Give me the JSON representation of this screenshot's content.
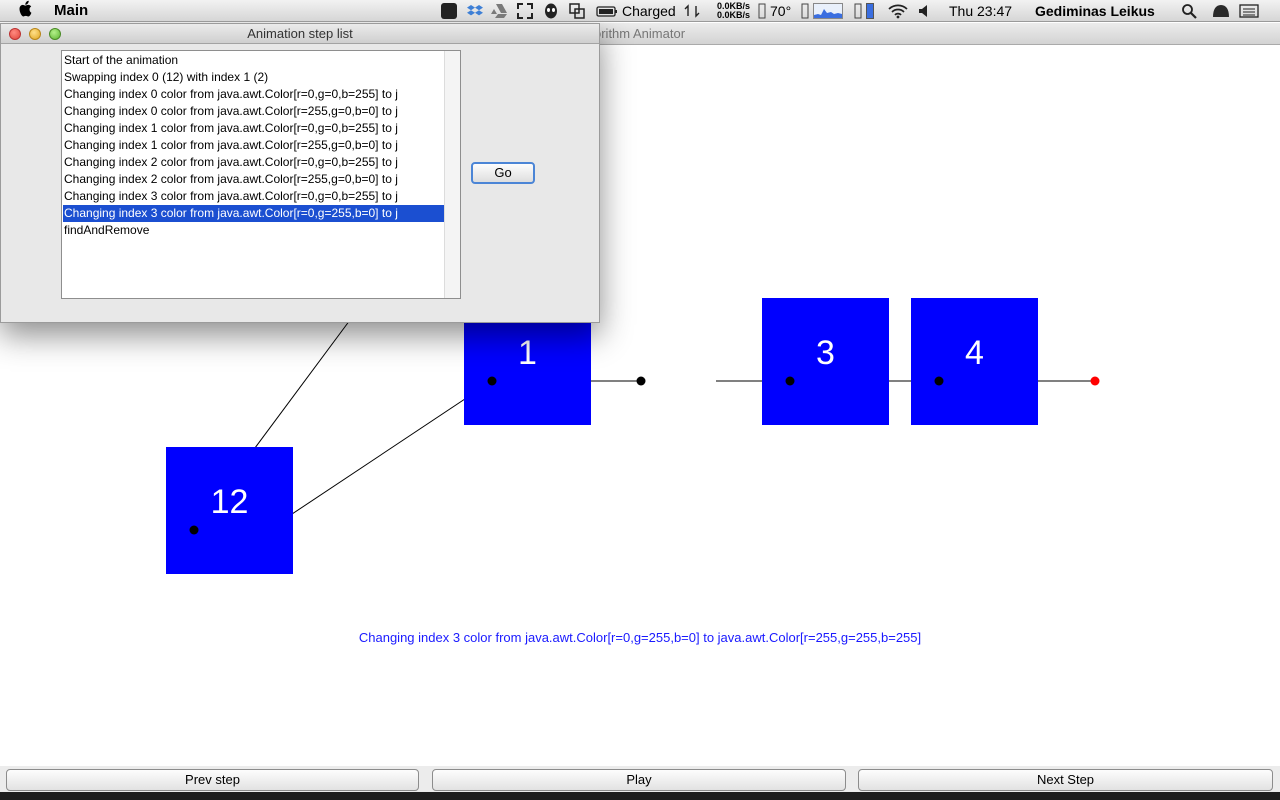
{
  "menubar": {
    "app_name": "Main",
    "battery_status": "Charged",
    "net_up": "0.0KB/s",
    "net_down": "0.0KB/s",
    "temperature": "70°",
    "clock": "Thu 23:47",
    "user": "Gediminas Leikus"
  },
  "main_window": {
    "title": "orithm Animator"
  },
  "nodes": [
    {
      "label": "12"
    },
    {
      "label": "1"
    },
    {
      "label": "3"
    },
    {
      "label": "4"
    }
  ],
  "status_text": "Changing index 3 color from java.awt.Color[r=0,g=255,b=0] to java.awt.Color[r=255,g=255,b=255]",
  "bottom_buttons": {
    "prev": "Prev step",
    "play": "Play",
    "next": "Next Step"
  },
  "dialog": {
    "title": "Animation step list",
    "go_label": "Go",
    "steps": [
      "Start of the animation",
      "Swapping index 0 (12)  with index 1 (2)",
      "Changing index 0 color from java.awt.Color[r=0,g=0,b=255] to j",
      "Changing index 0 color from java.awt.Color[r=255,g=0,b=0] to j",
      "Changing index 1 color from java.awt.Color[r=0,g=0,b=255] to j",
      "Changing index 1 color from java.awt.Color[r=255,g=0,b=0] to j",
      "Changing index 2 color from java.awt.Color[r=0,g=0,b=255] to j",
      "Changing index 2 color from java.awt.Color[r=255,g=0,b=0] to j",
      "Changing index 3 color from java.awt.Color[r=0,g=0,b=255] to j",
      "Changing index 3 color from java.awt.Color[r=0,g=255,b=0] to j",
      "findAndRemove"
    ],
    "selected_index": 9
  },
  "colors": {
    "node_fill": "#0000ff",
    "status_text": "#1a1aff",
    "selection": "#1b4fd1",
    "null_pointer": "#ff0000"
  }
}
